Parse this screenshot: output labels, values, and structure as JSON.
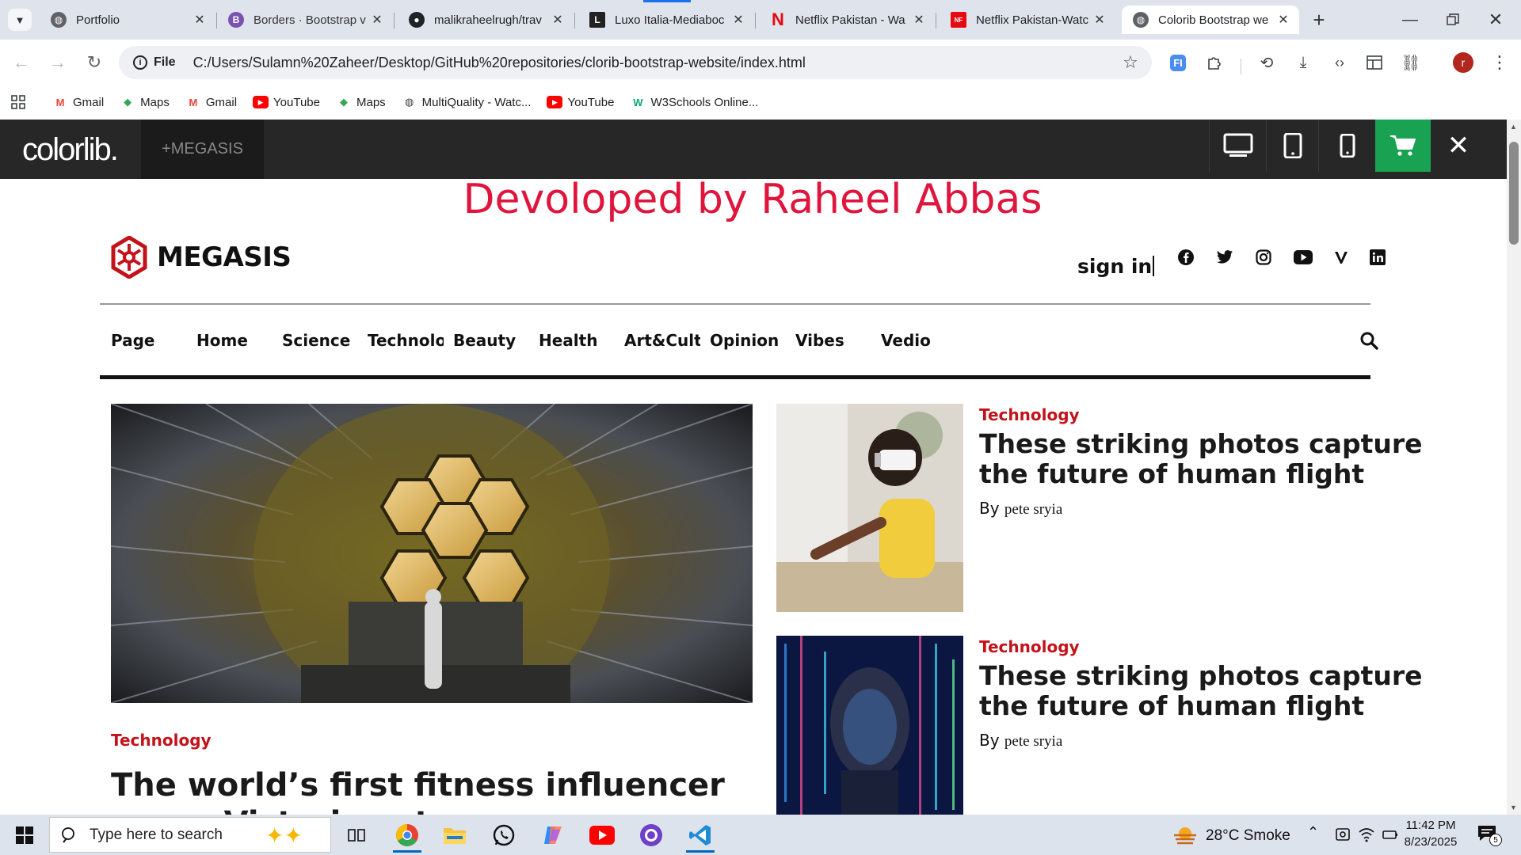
{
  "browser": {
    "tabs": [
      {
        "title": "Portfolio",
        "icon": "globe-icon"
      },
      {
        "title": "Borders · Bootstrap v",
        "icon": "bootstrap-icon"
      },
      {
        "title": "malikraheelrugh/trav",
        "icon": "github-icon"
      },
      {
        "title": "Luxo Italia-Mediaboc",
        "icon": "luxo-icon"
      },
      {
        "title": "Netflix Pakistan - Wa",
        "icon": "netflix-icon"
      },
      {
        "title": "Netflix Pakistan-Watc",
        "icon": "netflix-icon"
      },
      {
        "title": "Colorib Bootstrap we",
        "icon": "globe-icon",
        "active": true
      }
    ],
    "new_tab": "+",
    "address": {
      "chip": "File",
      "url": "C:/Users/Sulamn%20Zaheer/Desktop/GitHub%20repositories/clorib-bootstrap-website/index.html"
    },
    "profile_initial": "r",
    "bookmarks": [
      {
        "label": "Gmail",
        "icon": "gmail-icon"
      },
      {
        "label": "Maps",
        "icon": "maps-icon"
      },
      {
        "label": "Gmail",
        "icon": "gmail-icon"
      },
      {
        "label": "YouTube",
        "icon": "youtube-icon"
      },
      {
        "label": "Maps",
        "icon": "maps-icon"
      },
      {
        "label": "MultiQuality - Watc...",
        "icon": "globe-icon"
      },
      {
        "label": "YouTube",
        "icon": "youtube-icon"
      },
      {
        "label": "W3Schools Online...",
        "icon": "w3schools-icon"
      }
    ]
  },
  "demobar": {
    "logo": "colorlib.",
    "product": "+MEGASIS",
    "close": "✕"
  },
  "page": {
    "banner": "Devoloped by Raheel Abbas",
    "brand": "MEGASIS",
    "signin": "sign in",
    "social": [
      "facebook-icon",
      "twitter-icon",
      "instagram-icon",
      "youtube-icon",
      "vimeo-icon",
      "linkedin-icon"
    ],
    "nav": [
      "Page",
      "Home",
      "Science",
      "Technology",
      "Beauty",
      "Health",
      "Art&Culture",
      "Opinion",
      "Vibes",
      "Vedio"
    ],
    "main_story": {
      "category": "Technology",
      "headline": "The world’s first fitness influencer was a Victorian strongman"
    },
    "side_stories": [
      {
        "category": "Technology",
        "headline": "These striking photos capture the future of human flight",
        "by": "By",
        "author": "pete sryia"
      },
      {
        "category": "Technology",
        "headline": "These striking photos capture the future of human flight",
        "by": "By",
        "author": "pete sryia"
      }
    ]
  },
  "taskbar": {
    "search_placeholder": "Type here to search",
    "weather": "28°C  Smoke",
    "time": "11:42 PM",
    "date": "8/23/2025",
    "notifications": "5"
  },
  "colors": {
    "accent_red": "#e0153c",
    "category_red": "#c3121a",
    "cart_green": "#19a252",
    "demobar": "#272727"
  }
}
